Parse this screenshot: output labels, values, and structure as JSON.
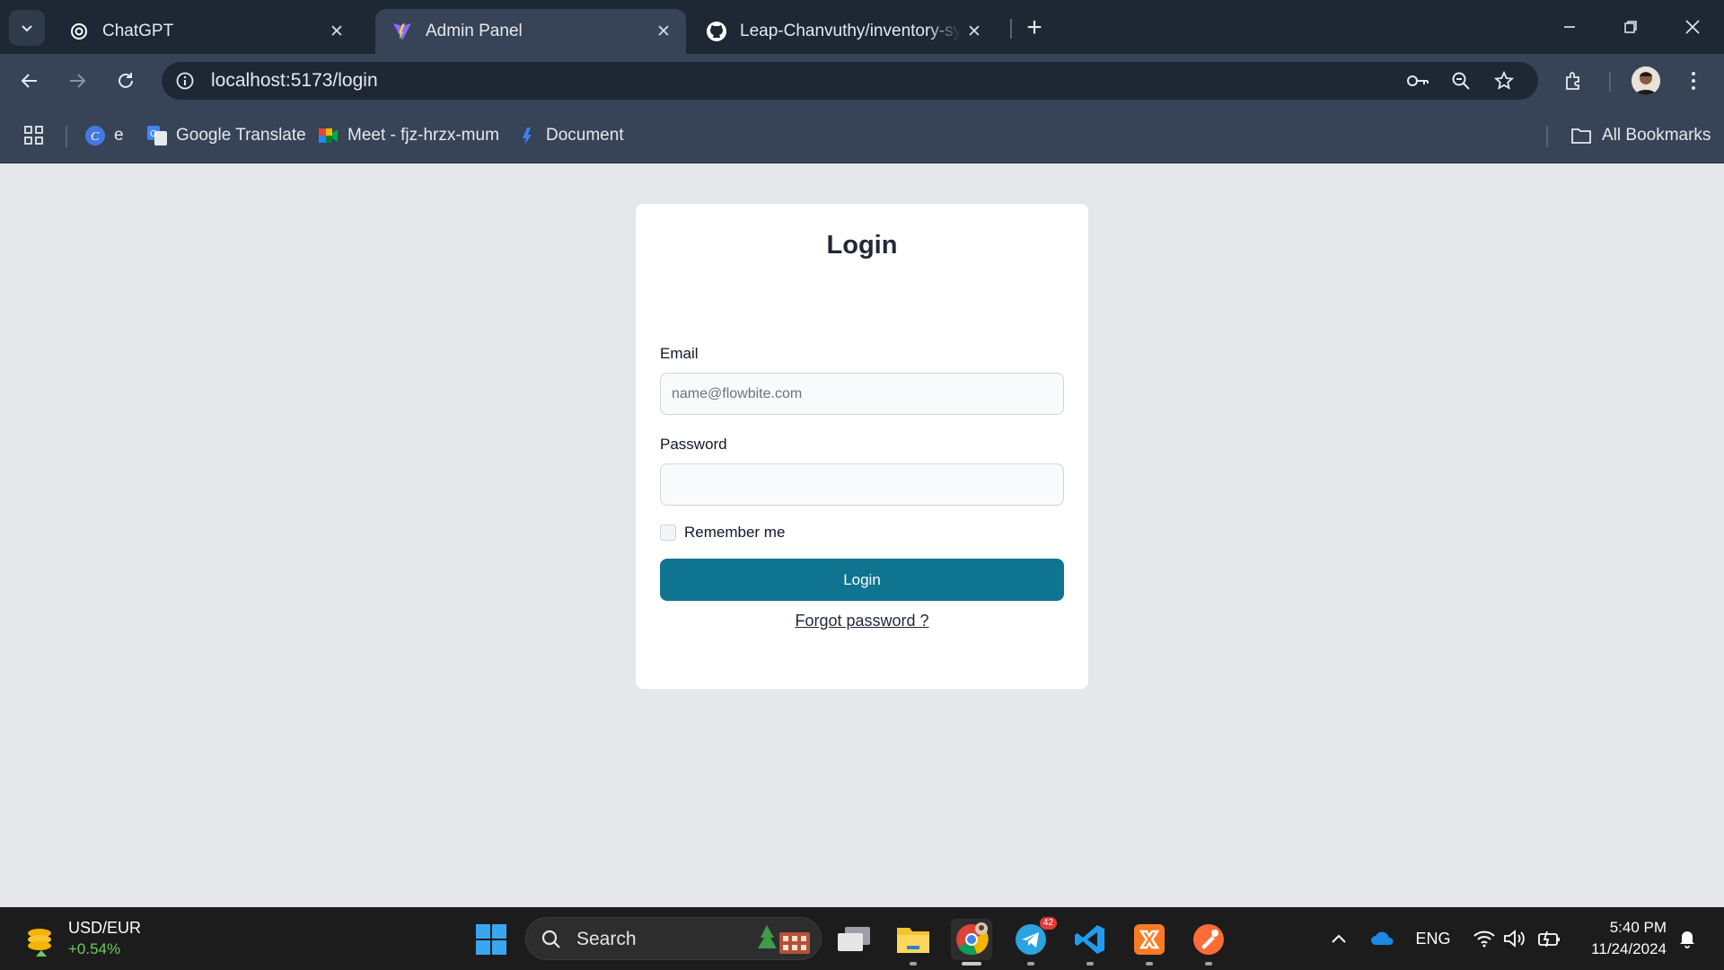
{
  "browser": {
    "tabs": [
      {
        "title": "ChatGPT",
        "icon": "chatgpt-icon",
        "active": false
      },
      {
        "title": "Admin Panel",
        "icon": "vite-icon",
        "active": true
      },
      {
        "title": "Leap-Chanvuthy/inventory-syst",
        "icon": "github-icon",
        "active": false
      }
    ],
    "url": "localhost:5173/login",
    "bookmarks": [
      {
        "label": "e",
        "icon": "canva-icon"
      },
      {
        "label": "Google Translate",
        "icon": "google-translate-icon"
      },
      {
        "label": "Meet - fjz-hrzx-mum",
        "icon": "google-meet-icon"
      },
      {
        "label": "Document",
        "icon": "document-icon"
      }
    ],
    "all_bookmarks": "All Bookmarks"
  },
  "login": {
    "title": "Login",
    "email_label": "Email",
    "email_placeholder": "name@flowbite.com",
    "email_value": "",
    "password_label": "Password",
    "password_value": "",
    "remember_label": "Remember me",
    "remember_checked": false,
    "submit_label": "Login",
    "forgot_label": "Forgot password ?",
    "accent": "#0e7490"
  },
  "taskbar": {
    "widget_title": "USD/EUR",
    "widget_value": "+0.54%",
    "search_label": "Search",
    "telegram_badge": "42",
    "language": "ENG",
    "time": "5:40 PM",
    "date": "11/24/2024"
  }
}
